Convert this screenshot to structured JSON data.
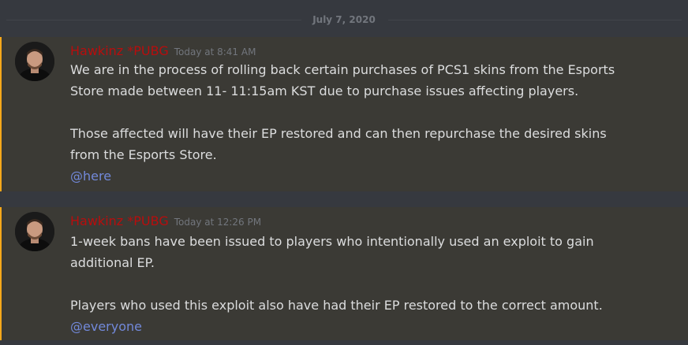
{
  "date_divider": "July 7, 2020",
  "messages": [
    {
      "author": "Hawkinz *PUBG",
      "timestamp": "Today at 8:41 AM",
      "paragraph1": "We are in the process of rolling back certain purchases of PCS1 skins from the Esports\nStore made between 11- 11:15am KST due to purchase issues affecting players.",
      "paragraph2": "Those affected will have their EP restored and can then repurchase the desired skins\nfrom the Esports Store.",
      "mention": "@here"
    },
    {
      "author": "Hawkinz *PUBG",
      "timestamp": "Today at 12:26 PM",
      "paragraph1": "1-week bans have been issued to players who intentionally used an exploit to gain\nadditional EP.",
      "paragraph2": "Players who used this exploit also have had their EP restored to the correct amount.",
      "mention": "@everyone"
    }
  ],
  "colors": {
    "background": "#36393f",
    "highlight_background": "#3b3a35",
    "highlight_bar": "#faa81a",
    "author": "#b80d0d",
    "mention": "#7289da"
  }
}
